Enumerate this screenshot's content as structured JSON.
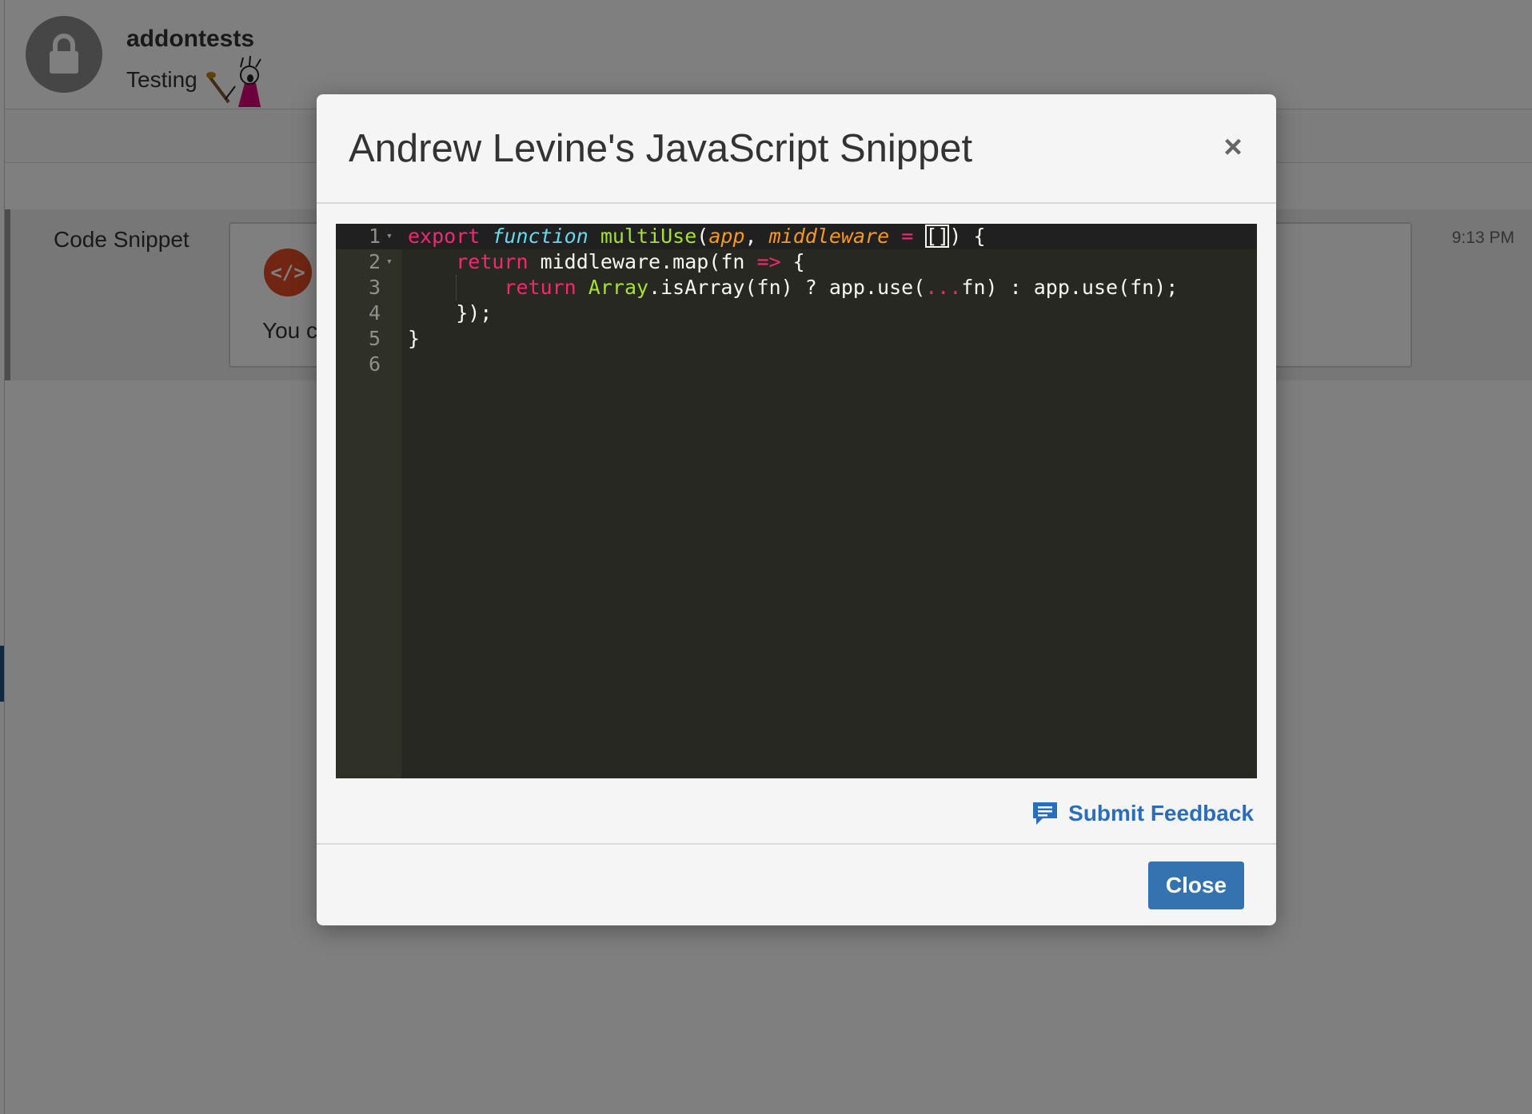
{
  "room": {
    "name": "addontests",
    "topic": "Testing"
  },
  "message": {
    "sender": "Code Snippet",
    "time": "9:13 PM",
    "icon_glyph": "</>",
    "preview_text": "You c"
  },
  "modal": {
    "title": "Andrew Levine's JavaScript Snippet",
    "close_x": "×",
    "feedback_label": "Submit Feedback",
    "close_button_label": "Close"
  },
  "code": {
    "line_numbers": [
      "1",
      "2",
      "3",
      "4",
      "5",
      "6"
    ],
    "lines": [
      [
        {
          "text": "export",
          "type": "kw"
        },
        {
          "text": " ",
          "type": "plain"
        },
        {
          "text": "function",
          "type": "storage"
        },
        {
          "text": " ",
          "type": "plain"
        },
        {
          "text": "multiUse",
          "type": "fn"
        },
        {
          "text": "(",
          "type": "plain"
        },
        {
          "text": "app",
          "type": "param"
        },
        {
          "text": ", ",
          "type": "plain"
        },
        {
          "text": "middleware",
          "type": "param"
        },
        {
          "text": " ",
          "type": "plain"
        },
        {
          "text": "=",
          "type": "op"
        },
        {
          "text": " ",
          "type": "plain"
        },
        {
          "text": "[]",
          "type": "bracket"
        },
        {
          "text": ") {",
          "type": "plain"
        }
      ],
      [
        {
          "text": "    ",
          "type": "plain"
        },
        {
          "text": "return",
          "type": "kw"
        },
        {
          "text": " middleware.map(fn ",
          "type": "plain"
        },
        {
          "text": "=>",
          "type": "op"
        },
        {
          "text": " {",
          "type": "plain"
        }
      ],
      [
        {
          "text": "        ",
          "type": "plain"
        },
        {
          "text": "return",
          "type": "kw"
        },
        {
          "text": " ",
          "type": "plain"
        },
        {
          "text": "Array",
          "type": "support"
        },
        {
          "text": ".isArray(fn) ? app.use(",
          "type": "plain"
        },
        {
          "text": "...",
          "type": "op"
        },
        {
          "text": "fn) : app.use(fn);",
          "type": "plain"
        }
      ],
      [
        {
          "text": "    });",
          "type": "plain"
        }
      ],
      [
        {
          "text": "}",
          "type": "plain"
        }
      ],
      []
    ],
    "foldable_lines": [
      1,
      2
    ]
  },
  "colors": {
    "editor_background": "#272822",
    "accent_button": "#3572b0",
    "link": "#2a6ebb",
    "snippet_icon": "#e14d26"
  },
  "icons": {
    "room_avatar": "lock-icon",
    "feedback": "speech-bubble-icon",
    "modal_close": "close-icon",
    "fold": "chevron-down-icon"
  }
}
